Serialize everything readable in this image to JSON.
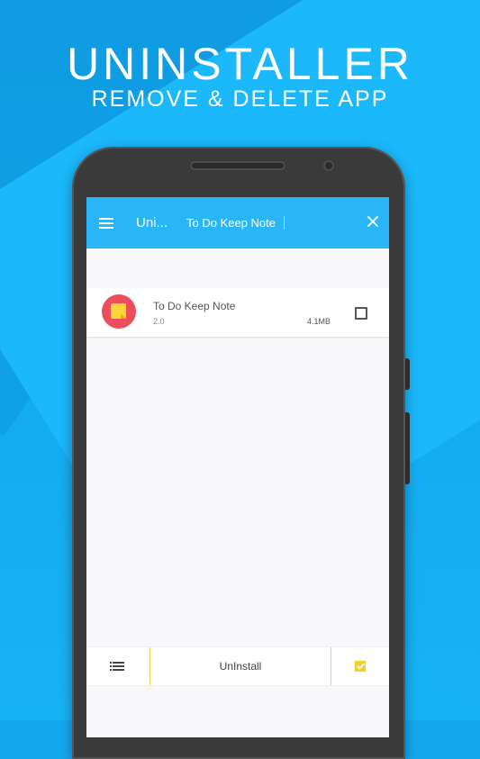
{
  "promo": {
    "title": "UNINSTALLER",
    "subtitle": "REMOVE & DELETE APP"
  },
  "appbar": {
    "title": "Uni...",
    "search_value": "To Do Keep Note",
    "menu_icon": "hamburger-menu-icon",
    "close_icon": "close-icon",
    "color": "#29b6f6"
  },
  "app_list": [
    {
      "name": "To Do Keep Note",
      "version": "2.0",
      "size": "4.1MB",
      "icon": "sticky-note-icon",
      "checked": false
    }
  ],
  "bottom_bar": {
    "list_icon": "list-view-icon",
    "uninstall_label": "UnInstall",
    "select_all_icon": "checkbox-checked-icon",
    "select_all_checked": true
  }
}
